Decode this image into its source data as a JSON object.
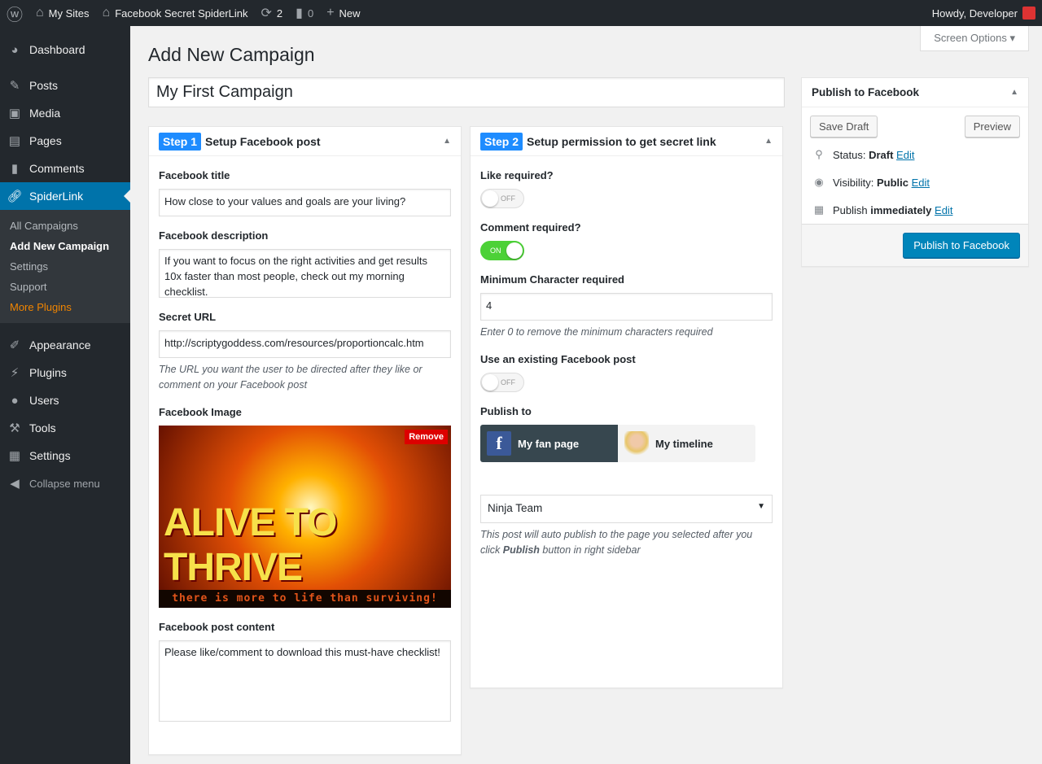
{
  "adminbar": {
    "my_sites": "My Sites",
    "site": "Facebook Secret SpiderLink",
    "updates": "2",
    "comments": "0",
    "new": "New",
    "howdy": "Howdy, Developer"
  },
  "sidebar": {
    "items": [
      {
        "label": "Dashboard",
        "icon": "dashboard-icon"
      },
      {
        "label": "Posts",
        "icon": "pin-icon"
      },
      {
        "label": "Media",
        "icon": "media-icon"
      },
      {
        "label": "Pages",
        "icon": "pages-icon"
      },
      {
        "label": "Comments",
        "icon": "comment-icon"
      },
      {
        "label": "SpiderLink",
        "icon": "link-icon"
      },
      {
        "label": "Appearance",
        "icon": "brush-icon"
      },
      {
        "label": "Plugins",
        "icon": "plugin-icon"
      },
      {
        "label": "Users",
        "icon": "user-icon"
      },
      {
        "label": "Tools",
        "icon": "wrench-icon"
      },
      {
        "label": "Settings",
        "icon": "settings-icon"
      }
    ],
    "submenu": [
      "All Campaigns",
      "Add New Campaign",
      "Settings",
      "Support",
      "More Plugins"
    ],
    "collapse": "Collapse menu"
  },
  "screen_options": "Screen Options",
  "page_title": "Add New Campaign",
  "post_title": "My First Campaign",
  "step1": {
    "badge": "Step 1",
    "title": "Setup Facebook post",
    "fb_title_label": "Facebook title",
    "fb_title": "How close to your values and goals are your living?",
    "fb_desc_label": "Facebook description",
    "fb_desc": "If you want to focus on the right activities and get results 10x faster than most people, check out my morning checklist.",
    "secret_url_label": "Secret URL",
    "secret_url": "http://scriptygoddess.com/resources/proportioncalc.htm",
    "secret_url_help": "The URL you want the user to be directed after they like or comment on your Facebook post",
    "image_label": "Facebook Image",
    "remove": "Remove",
    "image_logo": "ALIVE TO THRIVE",
    "image_tagline": "there is more to life than surviving!",
    "content_label": "Facebook post content",
    "content": "Please like/comment to download this must-have checklist!"
  },
  "step2": {
    "badge": "Step 2",
    "title": "Setup permission to get secret link",
    "like_label": "Like required?",
    "like": "OFF",
    "comment_label": "Comment required?",
    "comment": "ON",
    "min_label": "Minimum Character required",
    "min": "4",
    "min_help": "Enter 0 to remove the minimum characters required",
    "existing_label": "Use an existing Facebook post",
    "existing": "OFF",
    "publish_to_label": "Publish to",
    "fan_page": "My fan page",
    "timeline": "My timeline",
    "page_select": "Ninja Team",
    "help_pre": "This post will auto publish to the page you selected after you click ",
    "help_bold": "Publish",
    "help_post": " button in right sidebar"
  },
  "publish": {
    "title": "Publish to Facebook",
    "save_draft": "Save Draft",
    "preview": "Preview",
    "status_label": "Status: ",
    "status": "Draft",
    "visibility_label": "Visibility: ",
    "visibility": "Public",
    "publish_label": "Publish ",
    "publish_when": "immediately",
    "edit": "Edit",
    "button": "Publish to Facebook"
  }
}
